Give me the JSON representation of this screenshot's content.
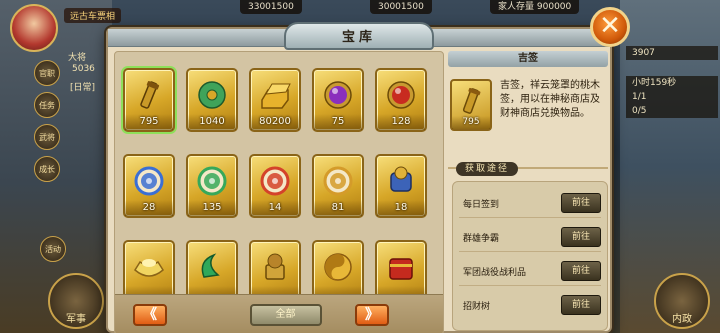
{
  "hud": {
    "player_banner": "远古车票相",
    "res_1": "33001500",
    "res_2": "30001500",
    "res_3": "900000",
    "res_3_label": "家人存量",
    "left_stat_name": "大将",
    "left_stat_value": "5036",
    "left_tag": "[日常]",
    "side_buttons": [
      "官职",
      "任务",
      "武将",
      "成长"
    ],
    "right_chips": [
      "3907",
      "小时159秒",
      "1/1",
      "0/5"
    ],
    "bottom_left": "军事",
    "bottom_right": "内政",
    "bottom_left_small": "活动"
  },
  "panel": {
    "title": "宝库",
    "close_label": "✕"
  },
  "items": [
    {
      "name": "吉签",
      "count": "795",
      "icon": "scroll-icon",
      "color": "#c99a28"
    },
    {
      "name": "玉佩",
      "count": "1040",
      "icon": "jade-disc-icon",
      "color": "#3fa35a"
    },
    {
      "name": "金砖",
      "count": "80200",
      "icon": "gold-bar-icon",
      "color": "#e7b22c"
    },
    {
      "name": "紫宝石",
      "count": "75",
      "icon": "purple-gem-icon",
      "color": "#8a2fbd"
    },
    {
      "name": "红宝石",
      "count": "128",
      "icon": "red-gem-icon",
      "color": "#c82b20"
    },
    {
      "name": "蓝符",
      "count": "28",
      "icon": "blue-orb-icon",
      "color": "#3a6fd4"
    },
    {
      "name": "绿符",
      "count": "135",
      "icon": "green-orb-icon",
      "color": "#37a85a"
    },
    {
      "name": "红符",
      "count": "14",
      "icon": "red-orb-icon",
      "color": "#d4422a"
    },
    {
      "name": "金符",
      "count": "81",
      "icon": "gold-orb-icon",
      "color": "#d49b2a"
    },
    {
      "name": "战甲",
      "count": "18",
      "icon": "armor-icon",
      "color": "#3c63b8"
    },
    {
      "name": "元宝",
      "count": "",
      "icon": "ingot-icon",
      "color": "#f0d560"
    },
    {
      "name": "玉璧",
      "count": "",
      "icon": "jade-crescent-icon",
      "color": "#2fa85a"
    },
    {
      "name": "金印",
      "count": "",
      "icon": "seal-icon",
      "color": "#d1a43a"
    },
    {
      "name": "太极",
      "count": "",
      "icon": "taiji-icon",
      "color": "#e8b838"
    },
    {
      "name": "红箱",
      "count": "",
      "icon": "red-box-icon",
      "color": "#c42a1e"
    }
  ],
  "footer": {
    "prev_label": "《",
    "filter_label": "全部",
    "next_label": "》"
  },
  "detail": {
    "title": "吉签",
    "count": "795",
    "description": "吉签，祥云笼罩的桃木签，用以在神秘商店及财神商店兑换物品。",
    "source_title": "获取途径",
    "sources": [
      {
        "label": "每日签到",
        "go": "前往"
      },
      {
        "label": "群雄争霸",
        "go": "前往"
      },
      {
        "label": "军团战役战利品",
        "go": "前往"
      },
      {
        "label": "招财树",
        "go": "前往"
      }
    ]
  }
}
